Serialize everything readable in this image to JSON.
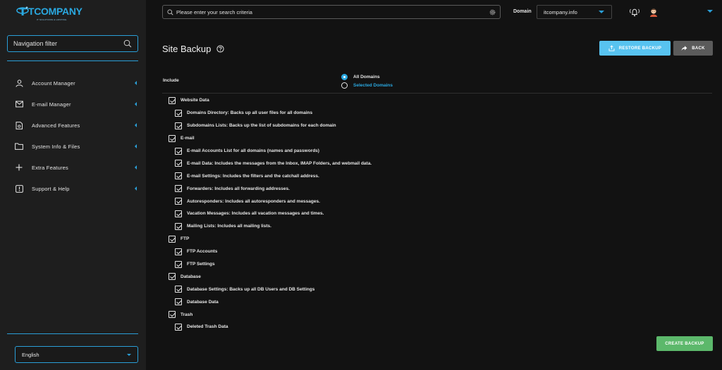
{
  "brand": {
    "name": "TCOMPANY",
    "tagline": "IT SOLUTIONS & HOSTING"
  },
  "colors": {
    "accent": "#2aa8e0",
    "sidebar_bg": "#1e1e1e",
    "page_bg": "#121212",
    "restore_btn": "#58c3f0",
    "back_btn": "#5b5b5b",
    "create_btn": "#5cb86b"
  },
  "sidebar": {
    "filter_placeholder": "Navigation filter",
    "items": [
      {
        "label": "Account Manager",
        "icon": "user-icon"
      },
      {
        "label": "E-mail Manager",
        "icon": "mail-icon"
      },
      {
        "label": "Advanced Features",
        "icon": "gear-file-icon"
      },
      {
        "label": "System Info & Files",
        "icon": "folder-icon"
      },
      {
        "label": "Extra Features",
        "icon": "plus-icon"
      },
      {
        "label": "Support & Help",
        "icon": "info-icon"
      }
    ],
    "language": "English"
  },
  "topbar": {
    "search_placeholder": "Please enter your search criteria",
    "domain_label": "Domain",
    "domain_value": "itcompany.info"
  },
  "page": {
    "title": "Site Backup",
    "restore_label": "RESTORE BACKUP",
    "back_label": "BACK",
    "create_label": "CREATE BACKUP",
    "include_label": "Include",
    "radio_all": "All Domains",
    "radio_selected": "Selected Domains",
    "sections": [
      {
        "label": "Website Data",
        "children": [
          "Domains Directory: Backs up all user files for all domains",
          "Subdomains Lists: Backs up the list of subdomains for each domain"
        ]
      },
      {
        "label": "E-mail",
        "children": [
          "E-mail Accounts List for all domains (names and passwords)",
          "E-mail Data: Includes the messages from the Inbox, IMAP Folders, and webmail data.",
          "E-mail Settings: Includes the filters and the catchall address.",
          "Forwarders: Includes all forwarding addresses.",
          "Autoresponders: Includes all autoresponders and messages.",
          "Vacation Messages: Includes all vacation messages and times.",
          "Mailing Lists: Includes all mailing lists."
        ]
      },
      {
        "label": "FTP",
        "children": [
          "FTP Accounts",
          "FTP Settings"
        ]
      },
      {
        "label": "Database",
        "children": [
          "Database Settings: Backs up all DB Users and DB Settings",
          "Database Data"
        ]
      },
      {
        "label": "Trash",
        "children": [
          "Deleted Trash Data"
        ]
      }
    ]
  }
}
